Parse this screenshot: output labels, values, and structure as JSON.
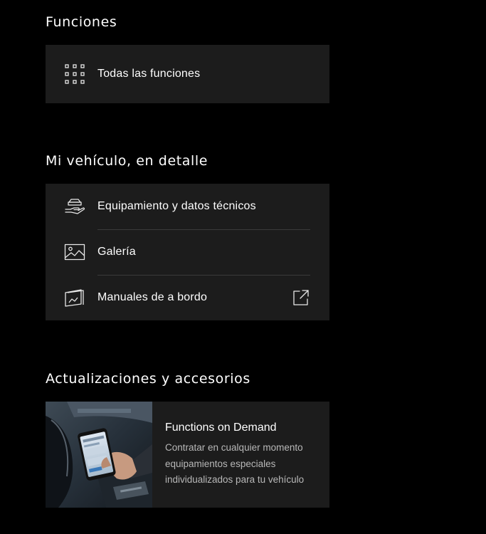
{
  "sections": {
    "functions": {
      "title": "Funciones",
      "items": [
        {
          "label": "Todas las funciones",
          "icon": "grid-icon"
        }
      ]
    },
    "vehicle": {
      "title": "Mi vehículo, en detalle",
      "items": [
        {
          "label": "Equipamiento y datos técnicos",
          "icon": "hand-car-icon"
        },
        {
          "label": "Galería",
          "icon": "image-icon"
        },
        {
          "label": "Manuales de a bordo",
          "icon": "manual-icon",
          "trailing_icon": "external-link-icon"
        }
      ]
    },
    "updates": {
      "title": "Actualizaciones y accesorios",
      "promo": {
        "title": "Functions on Demand",
        "description": "Contratar en cualquier momento equipamientos especiales individualizados para tu vehículo",
        "image": "car-interior-phone-photo"
      }
    }
  },
  "colors": {
    "background": "#000000",
    "card": "#1c1c1c",
    "divider": "#3a3a3a",
    "text_primary": "#ffffff",
    "text_secondary": "#b8b8b8"
  }
}
